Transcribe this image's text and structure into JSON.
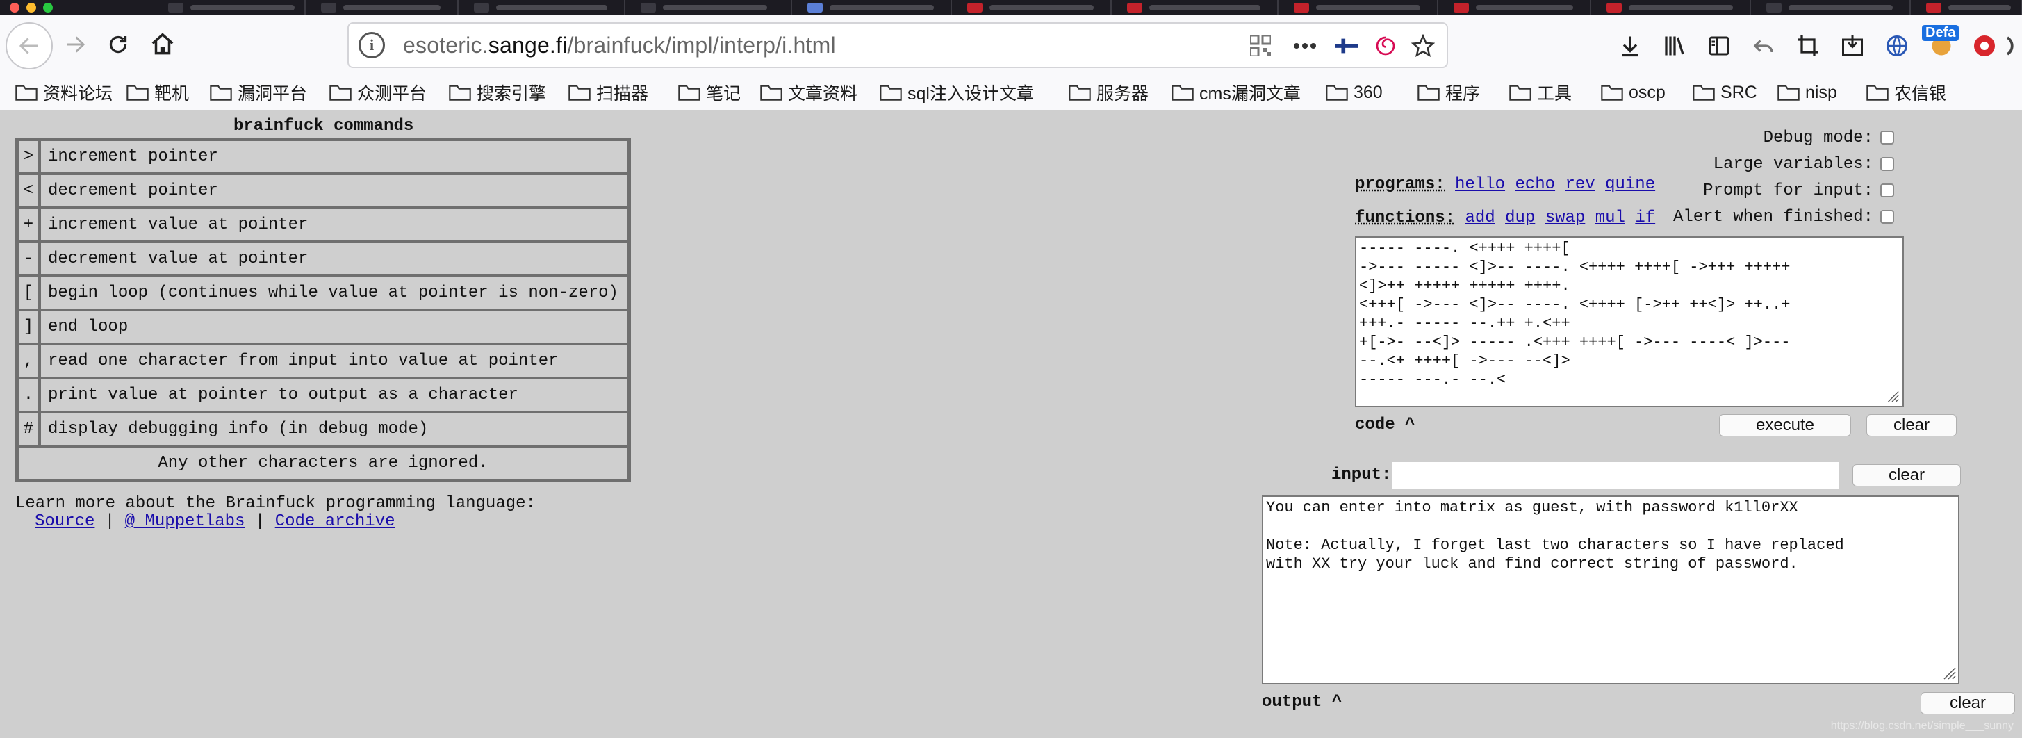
{
  "browser": {
    "url_prefix": "esoteric.",
    "url_domain": "sange.fi",
    "url_path": "/brainfuck/impl/interp/i.html",
    "profile_badge": "Defa"
  },
  "bookmarks": [
    "资料论坛",
    "靶机",
    "漏洞平台",
    "众测平台",
    "搜索引擎",
    "扫描器",
    "笔记",
    "文章资料",
    "sql注入设计文章",
    "服务器",
    "cms漏洞文章",
    "360",
    "程序",
    "工具",
    "oscp",
    "SRC",
    "nisp",
    "农信银"
  ],
  "commands": {
    "title": "brainfuck commands",
    "rows": [
      {
        "sym": ">",
        "desc": "increment pointer"
      },
      {
        "sym": "<",
        "desc": "decrement pointer"
      },
      {
        "sym": "+",
        "desc": "increment value at pointer"
      },
      {
        "sym": "-",
        "desc": "decrement value at pointer"
      },
      {
        "sym": "[",
        "desc": "begin loop (continues while value at pointer is non-zero)"
      },
      {
        "sym": "]",
        "desc": "end loop"
      },
      {
        "sym": ",",
        "desc": "read one character from input into value at pointer"
      },
      {
        "sym": ".",
        "desc": "print value at pointer to output as a character"
      },
      {
        "sym": "#",
        "desc": "display debugging info (in debug mode)"
      }
    ],
    "footer": "Any other characters are ignored."
  },
  "learn": {
    "text": "Learn more about the Brainfuck programming language:",
    "links": [
      "Source",
      "@ Muppetlabs",
      "Code archive"
    ],
    "sep": "|"
  },
  "options": [
    {
      "label": "Debug mode:",
      "checked": false
    },
    {
      "label": "Large variables:",
      "checked": false
    },
    {
      "label": "Prompt for input:",
      "checked": false
    },
    {
      "label": "Alert when finished:",
      "checked": false
    }
  ],
  "programs": {
    "label": "programs:",
    "items": [
      "hello",
      "echo",
      "rev",
      "quine"
    ]
  },
  "functions": {
    "label": "functions:",
    "items": [
      "add",
      "dup",
      "swap",
      "mul",
      "if"
    ]
  },
  "code": {
    "value": "----- ----. <++++ ++++[\n->--- ----- <]>-- ----. <++++ ++++[ ->+++ +++++\n<]>++ +++++ +++++ ++++.\n<+++[ ->--- <]>-- ----. <++++ [->++ ++<]> ++..+\n+++.- ----- --.++ +.<++\n+[->- --<]> ----- .<+++ ++++[ ->--- ----< ]>---\n--.<+ ++++[ ->--- --<]>\n----- ---.- --.<",
    "label": "code ^",
    "execute": "execute",
    "clear": "clear"
  },
  "input": {
    "label": "input:",
    "value": "",
    "clear": "clear"
  },
  "output": {
    "value": "You can enter into matrix as guest, with password k1ll0rXX\n\nNote: Actually, I forget last two characters so I have replaced\nwith XX try your luck and find correct string of password.",
    "label": "output ^",
    "clear": "clear"
  },
  "watermark": "https://blog.csdn.net/simple___sunny"
}
